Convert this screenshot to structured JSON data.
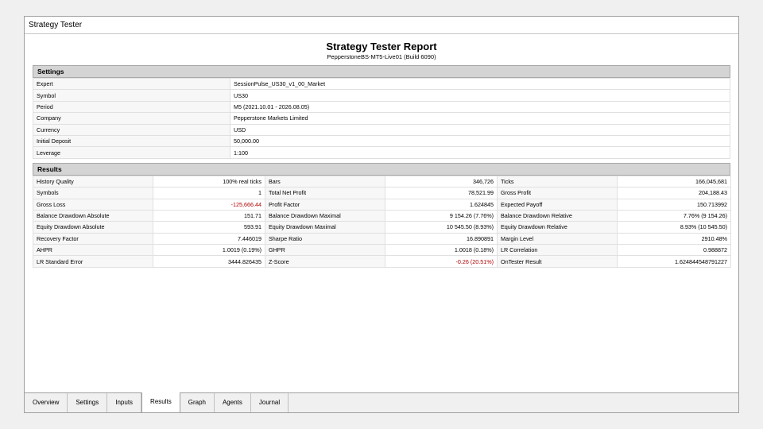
{
  "window": {
    "title": "Strategy Tester"
  },
  "report": {
    "title": "Strategy Tester Report",
    "subtitle": "PepperstoneBS-MT5-Live01 (Build 6090)"
  },
  "settings": {
    "header": "Settings",
    "rows": [
      {
        "label": "Expert",
        "value": "SessionPulse_US30_v1_00_Market"
      },
      {
        "label": "Symbol",
        "value": "US30"
      },
      {
        "label": "Period",
        "value": "M5 (2021.10.01 - 2026.08.05)"
      },
      {
        "label": "Company",
        "value": "Pepperstone Markets Limited"
      },
      {
        "label": "Currency",
        "value": "USD"
      },
      {
        "label": "Initial Deposit",
        "value": "50,000.00"
      },
      {
        "label": "Leverage",
        "value": "1:100"
      }
    ]
  },
  "results": {
    "header": "Results",
    "rows": [
      [
        {
          "label": "History Quality",
          "value": "100% real ticks"
        },
        {
          "label": "Bars",
          "value": "346,726"
        },
        {
          "label": "Ticks",
          "value": "166,045,681"
        }
      ],
      [
        {
          "label": "Symbols",
          "value": "1"
        },
        {
          "label": "Total Net Profit",
          "value": "78,521.99"
        },
        {
          "label": "Gross Profit",
          "value": "204,188.43"
        }
      ],
      [
        {
          "label": "Gross Loss",
          "value": "-125,666.44"
        },
        {
          "label": "Profit Factor",
          "value": "1.624845"
        },
        {
          "label": "Expected Payoff",
          "value": "150.713992"
        }
      ],
      [
        {
          "label": "Balance Drawdown Absolute",
          "value": "151.71"
        },
        {
          "label": "Balance Drawdown Maximal",
          "value": "9 154.26 (7.76%)"
        },
        {
          "label": "Balance Drawdown Relative",
          "value": "7.76% (9 154.26)"
        }
      ],
      [
        {
          "label": "Equity Drawdown Absolute",
          "value": "593.91"
        },
        {
          "label": "Equity Drawdown Maximal",
          "value": "10 545.50 (8.93%)"
        },
        {
          "label": "Equity Drawdown Relative",
          "value": "8.93% (10 545.50)"
        }
      ],
      [
        {
          "label": "Recovery Factor",
          "value": "7.446019"
        },
        {
          "label": "Sharpe Ratio",
          "value": "16.890891"
        },
        {
          "label": "Margin Level",
          "value": "2910.48%"
        }
      ],
      [
        {
          "label": "AHPR",
          "value": "1.0019 (0.19%)"
        },
        {
          "label": "GHPR",
          "value": "1.0018 (0.18%)"
        },
        {
          "label": "LR Correlation",
          "value": "0.988872"
        }
      ],
      [
        {
          "label": "LR Standard Error",
          "value": "3444.826435"
        },
        {
          "label": "Z-Score",
          "value": "-0.26 (20.51%)"
        },
        {
          "label": "OnTester Result",
          "value": "1.624844548791227"
        }
      ]
    ],
    "negative_color": "#b00000"
  },
  "tabs": [
    {
      "label": "Overview",
      "active": false
    },
    {
      "label": "Settings",
      "active": false
    },
    {
      "label": "Inputs",
      "active": false
    },
    {
      "label": "Results",
      "active": true
    },
    {
      "label": "Graph",
      "active": false
    },
    {
      "label": "Agents",
      "active": false
    },
    {
      "label": "Journal",
      "active": false
    }
  ]
}
